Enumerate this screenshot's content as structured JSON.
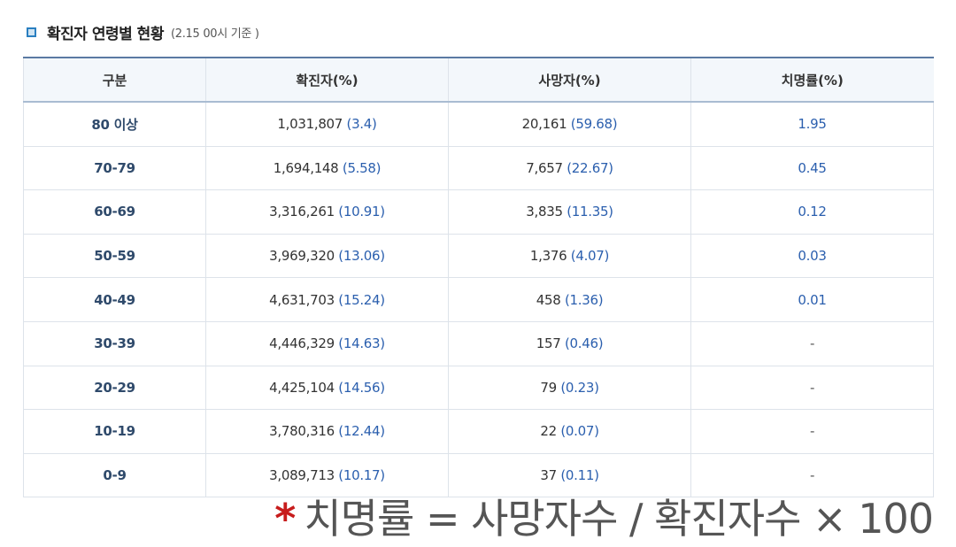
{
  "header": {
    "title": "확진자 연령별 현황",
    "subtitle": "(2.15 00시 기준 )"
  },
  "table": {
    "columns": [
      "구분",
      "확진자(%)",
      "사망자(%)",
      "치명률(%)"
    ],
    "rows": [
      {
        "age": "80 이상",
        "cases": "1,031,807",
        "cases_pct": "(3.4)",
        "deaths": "20,161",
        "deaths_pct": "(59.68)",
        "cfr": "1.95"
      },
      {
        "age": "70-79",
        "cases": "1,694,148",
        "cases_pct": "(5.58)",
        "deaths": "7,657",
        "deaths_pct": "(22.67)",
        "cfr": "0.45"
      },
      {
        "age": "60-69",
        "cases": "3,316,261",
        "cases_pct": "(10.91)",
        "deaths": "3,835",
        "deaths_pct": "(11.35)",
        "cfr": "0.12"
      },
      {
        "age": "50-59",
        "cases": "3,969,320",
        "cases_pct": "(13.06)",
        "deaths": "1,376",
        "deaths_pct": "(4.07)",
        "cfr": "0.03"
      },
      {
        "age": "40-49",
        "cases": "4,631,703",
        "cases_pct": "(15.24)",
        "deaths": "458",
        "deaths_pct": "(1.36)",
        "cfr": "0.01"
      },
      {
        "age": "30-39",
        "cases": "4,446,329",
        "cases_pct": "(14.63)",
        "deaths": "157",
        "deaths_pct": "(0.46)",
        "cfr": "-"
      },
      {
        "age": "20-29",
        "cases": "4,425,104",
        "cases_pct": "(14.56)",
        "deaths": "79",
        "deaths_pct": "(0.23)",
        "cfr": "-"
      },
      {
        "age": "10-19",
        "cases": "3,780,316",
        "cases_pct": "(12.44)",
        "deaths": "22",
        "deaths_pct": "(0.07)",
        "cfr": "-"
      },
      {
        "age": "0-9",
        "cases": "3,089,713",
        "cases_pct": "(10.17)",
        "deaths": "37",
        "deaths_pct": "(0.11)",
        "cfr": "-"
      }
    ]
  },
  "footnote": {
    "star": "*",
    "text": "치명률 = 사망자수 / 확진자수 × 100"
  },
  "colors": {
    "accent": "#2b5fae",
    "header_border": "#5b7aa3",
    "star": "#c71c1c"
  }
}
